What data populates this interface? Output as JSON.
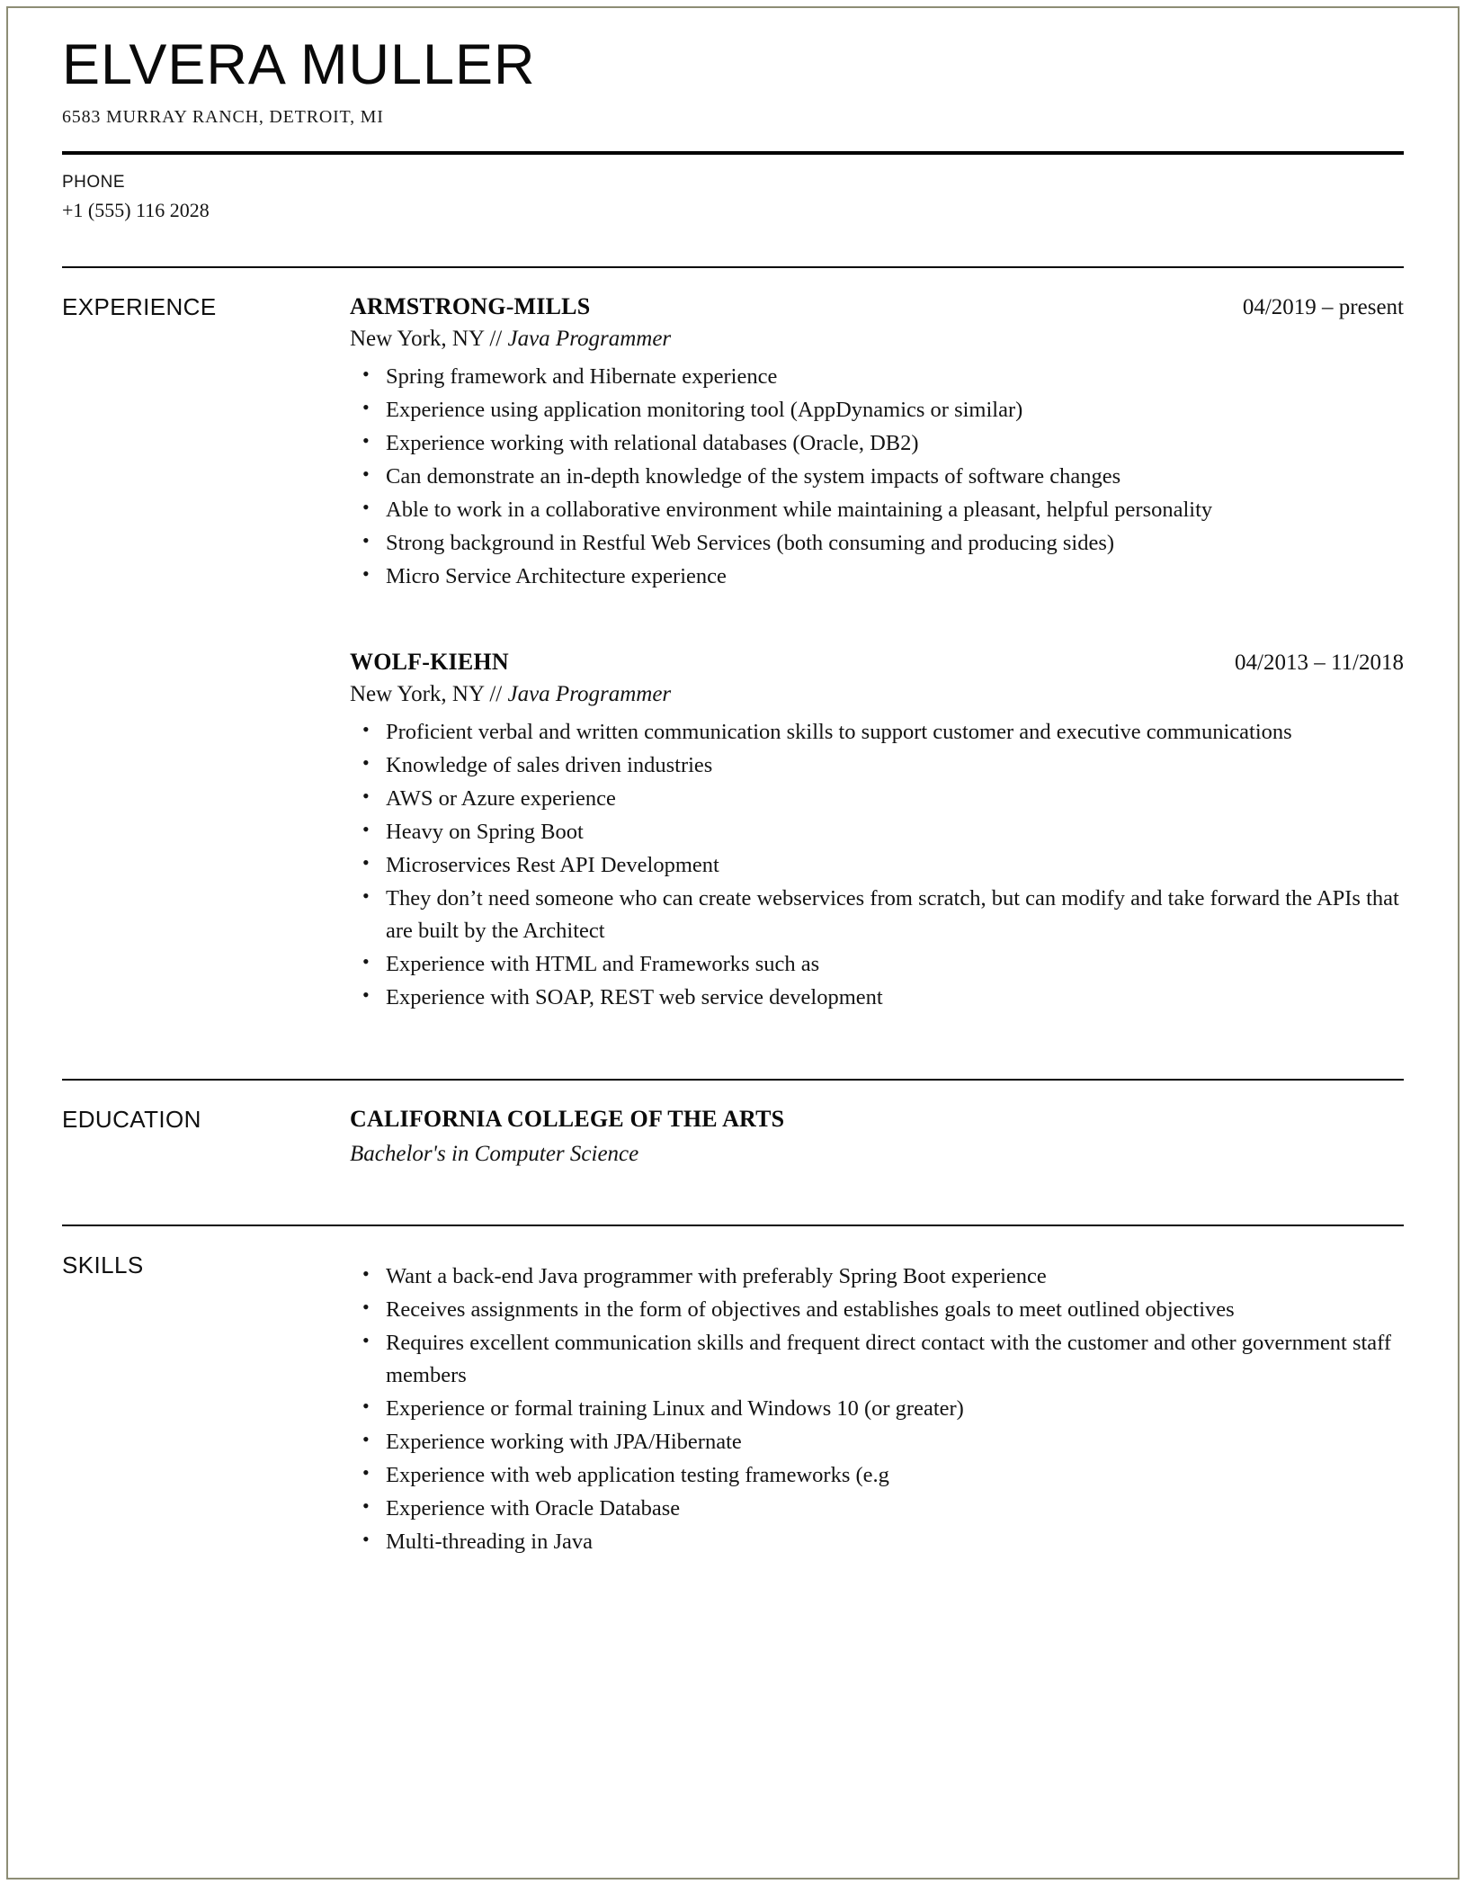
{
  "document": {
    "type": "resume"
  },
  "header": {
    "name": "ELVERA MULLER",
    "address": "6583 MURRAY RANCH, DETROIT, MI"
  },
  "contact": {
    "phone_label": "PHONE",
    "phone_value": "+1 (555) 116 2028"
  },
  "sections": {
    "experience": {
      "label": "EXPERIENCE",
      "entries": [
        {
          "organization": "ARMSTRONG-MILLS",
          "date": "04/2019 – present",
          "location": "New York, NY // ",
          "role": "Java Programmer",
          "bullets": [
            "Spring framework and Hibernate experience",
            "Experience using application monitoring tool (AppDynamics or similar)",
            "Experience working with relational databases (Oracle, DB2)",
            "Can demonstrate an in-depth knowledge of the system impacts of software changes",
            "Able to work in a collaborative environment while maintaining a pleasant, helpful personality",
            "Strong background in Restful Web Services (both consuming and producing sides)",
            "Micro Service Architecture experience"
          ]
        },
        {
          "organization": "WOLF-KIEHN",
          "date": "04/2013 – 11/2018",
          "location": "New York, NY // ",
          "role": "Java Programmer",
          "bullets": [
            "Proficient verbal and written communication skills to support customer and executive communications",
            "Knowledge of sales driven industries",
            "AWS or Azure experience",
            "Heavy on Spring Boot",
            "Microservices Rest API Development",
            "They don’t need someone who can create webservices from scratch, but can modify and take forward the APIs that are built by the Architect",
            "Experience with HTML and Frameworks such as",
            "Experience with SOAP, REST web service development"
          ]
        }
      ]
    },
    "education": {
      "label": "EDUCATION",
      "entries": [
        {
          "school": "CALIFORNIA COLLEGE OF THE ARTS",
          "degree": "Bachelor's in Computer Science"
        }
      ]
    },
    "skills": {
      "label": "SKILLS",
      "bullets": [
        "Want a back-end Java programmer with preferably Spring Boot experience",
        "Receives assignments in the form of objectives and establishes goals to meet outlined objectives",
        "Requires excellent communication skills and frequent direct contact with the customer and other government staff members",
        "Experience or formal training Linux and Windows 10 (or greater)",
        "Experience working with JPA/Hibernate",
        "Experience with web application testing frameworks (e.g",
        "Experience with Oracle Database",
        "Multi-threading in Java"
      ]
    }
  },
  "colors": {
    "text": "#141414",
    "rule": "#050505",
    "page_border": "#8d8d75",
    "background": "#ffffff"
  }
}
